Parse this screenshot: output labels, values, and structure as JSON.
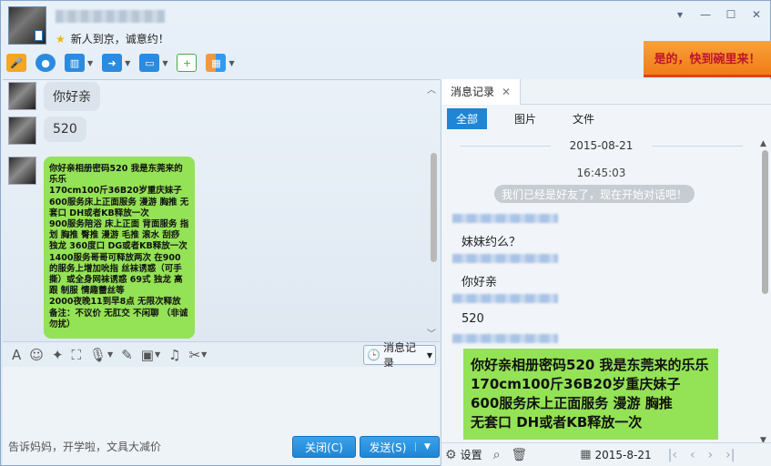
{
  "header": {
    "signature": "新人到京，诚意约！",
    "window_controls": [
      "▾",
      "—",
      "☐",
      "✕"
    ]
  },
  "toolbar": {
    "items": [
      "mic-icon",
      "video-icon",
      "screen-share-icon",
      "file-transfer-icon",
      "remote-desktop-icon",
      "add-chat-icon",
      "apps-icon"
    ]
  },
  "ad": {
    "banner_text": "是的，快到碗里来！"
  },
  "chat": {
    "messages": [
      {
        "text": "你好亲"
      },
      {
        "text": "520"
      },
      {
        "text": "你好亲相册密码520 我是东莞来的乐乐\n170cm100斤36B20岁重庆妹子\n600服务床上正面服务 漫游 胸推 无套口 DH或者KB释放一次\n900服务陪浴 床上正面 背面服务 指划 胸推 臀推 漫游 毛推 滚水 刮痧 独龙 360度口 DG或者KB释放一次\n1400服务哥哥可释放两次 在900的服务上增加吮指 丝袜诱惑（可手撕）或全身网袜诱惑 69式 独龙 高跟 制服 情趣蕾丝等\n2000夜晚11到早8点 无限次释放 备注：不议价 无肛交 不闲聊 （非诚勿扰）"
      }
    ]
  },
  "input": {
    "history_label": "消息记录",
    "ad_text": "告诉妈妈，开学啦，文具大减价",
    "close_label": "关闭(C)",
    "send_label": "发送(S)"
  },
  "history": {
    "tab_title": "消息记录",
    "filters": [
      "全部",
      "图片",
      "文件"
    ],
    "date": "2015-08-21",
    "time": "16:45:03",
    "system_msg": "我们已经是好友了，现在开始对话吧！",
    "entries": [
      "妹妹约么？",
      "你好亲",
      "520"
    ],
    "green_msg": "你好亲相册密码520 我是东莞来的乐乐\n170cm100斤36B20岁重庆妹子\n600服务床上正面服务 漫游 胸推\n无套口 DH或者KB释放一次",
    "footer": {
      "settings": "设置",
      "date": "2015-8-21"
    }
  }
}
